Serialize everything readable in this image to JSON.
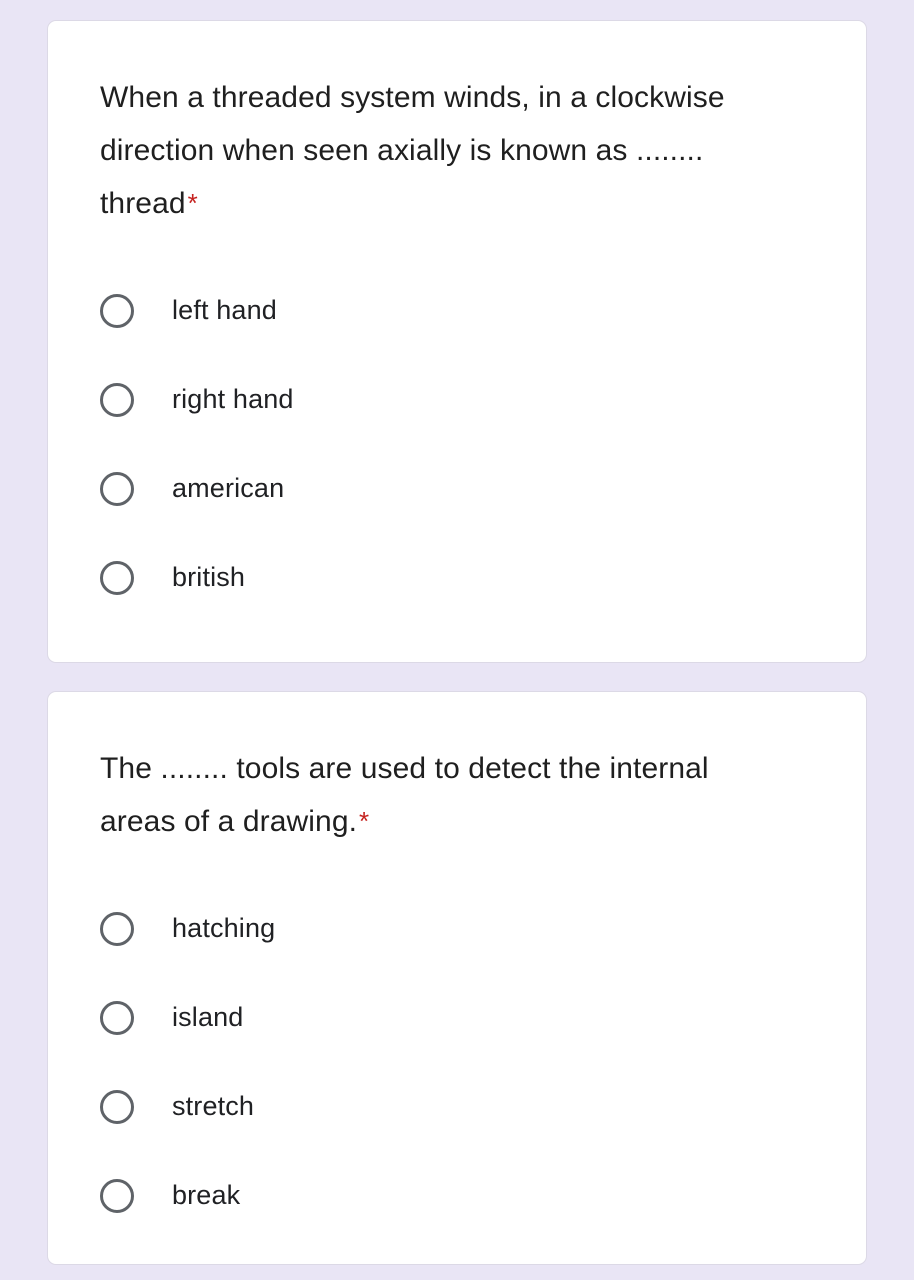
{
  "page": {
    "background_color": "#e9e5f5",
    "card_background_color": "#ffffff",
    "required_marker": "*",
    "required_marker_color": "#c5221f"
  },
  "questions": [
    {
      "id": "question-1",
      "text": "When a threaded system winds, in a clockwise direction when seen axially is known as ........ thread",
      "required": true,
      "selected": null,
      "options": [
        {
          "label": "left hand",
          "selected": false
        },
        {
          "label": "right hand",
          "selected": false
        },
        {
          "label": "american",
          "selected": false
        },
        {
          "label": "british",
          "selected": false
        }
      ]
    },
    {
      "id": "question-2",
      "text": "The ........ tools are used to detect the internal areas of a drawing.",
      "required": true,
      "selected": null,
      "options": [
        {
          "label": "hatching",
          "selected": false
        },
        {
          "label": "island",
          "selected": false
        },
        {
          "label": "stretch",
          "selected": false
        },
        {
          "label": "break",
          "selected": false
        }
      ]
    }
  ]
}
